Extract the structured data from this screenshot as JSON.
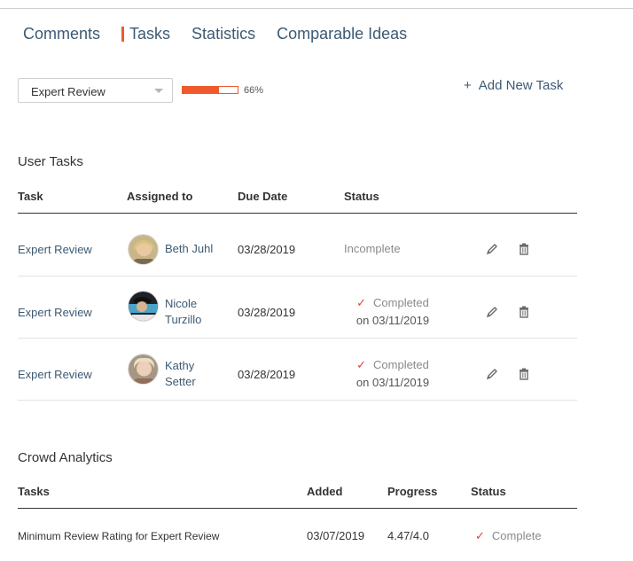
{
  "tabs": [
    {
      "label": "Comments",
      "active": false
    },
    {
      "label": "Tasks",
      "active": true
    },
    {
      "label": "Statistics",
      "active": false
    },
    {
      "label": "Comparable Ideas",
      "active": false
    }
  ],
  "stage_select": {
    "value": "Expert Review"
  },
  "progress": {
    "percent": 66,
    "label": "66%"
  },
  "add_task": {
    "plus": "+",
    "label": "Add New Task"
  },
  "user_tasks": {
    "title": "User Tasks",
    "headers": {
      "task": "Task",
      "assigned": "Assigned to",
      "due": "Due Date",
      "status": "Status"
    },
    "rows": [
      {
        "task": "Expert Review",
        "assignee_line1": "Beth Juhl",
        "assignee_line2": "",
        "due": "03/28/2019",
        "status_line1": "Incomplete",
        "status_line2": "",
        "completed": false
      },
      {
        "task": "Expert Review",
        "assignee_line1": "Nicole",
        "assignee_line2": "Turzillo",
        "due": "03/28/2019",
        "status_line1": "Completed",
        "status_line2": "on 03/11/2019",
        "completed": true
      },
      {
        "task": "Expert Review",
        "assignee_line1": "Kathy",
        "assignee_line2": "Setter",
        "due": "03/28/2019",
        "status_line1": "Completed",
        "status_line2": "on 03/11/2019",
        "completed": true
      }
    ]
  },
  "crowd_analytics": {
    "title": "Crowd Analytics",
    "headers": {
      "tasks": "Tasks",
      "added": "Added",
      "progress": "Progress",
      "status": "Status"
    },
    "rows": [
      {
        "task": "Minimum Review Rating for Expert Review",
        "added": "03/07/2019",
        "progress": "4.47/4.0",
        "status": "Complete"
      }
    ]
  },
  "colors": {
    "accent": "#ef5a2d",
    "link": "#3d5a73",
    "check": "#e8412c"
  },
  "icons": {
    "edit": "pencil-icon",
    "delete": "trash-icon",
    "check": "checkmark-icon",
    "dropdown": "caret-down-icon"
  }
}
